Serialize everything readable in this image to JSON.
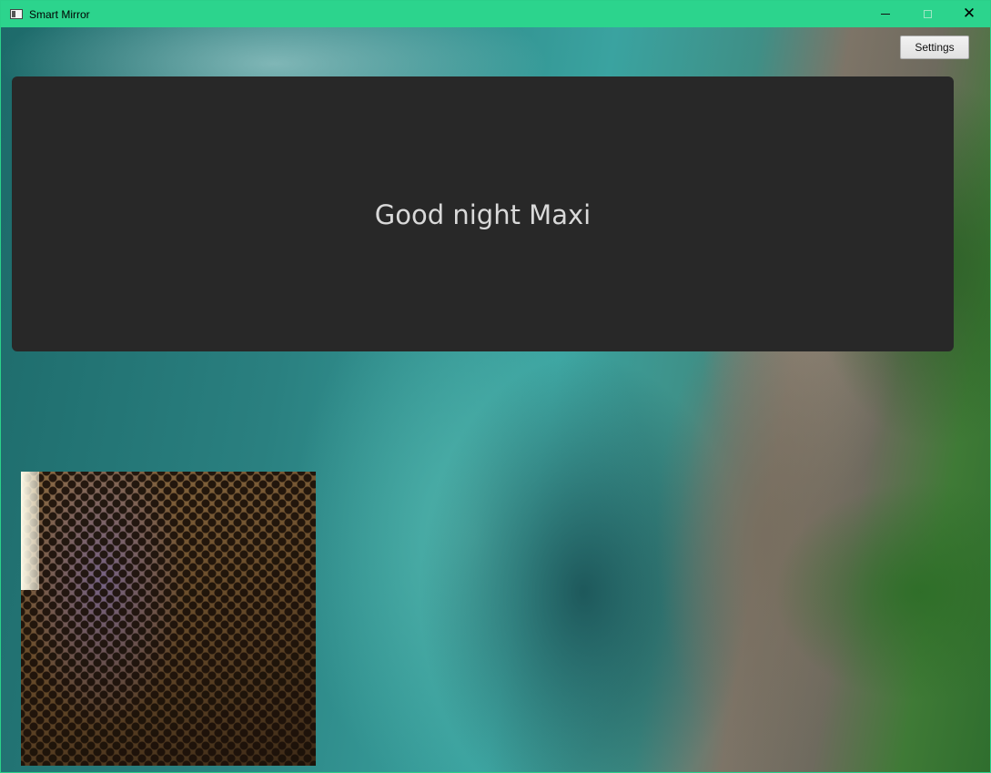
{
  "window": {
    "title": "Smart Mirror",
    "accent_color": "#2cd48d",
    "controls": {
      "minimize_icon": "minimize-icon",
      "maximize_icon": "maximize-icon",
      "close_icon": "close-icon",
      "close_glyph": "✕"
    }
  },
  "toolbar": {
    "settings_label": "Settings"
  },
  "greeting": {
    "text": "Good night Maxi"
  },
  "camera": {
    "name": "camera-preview"
  }
}
